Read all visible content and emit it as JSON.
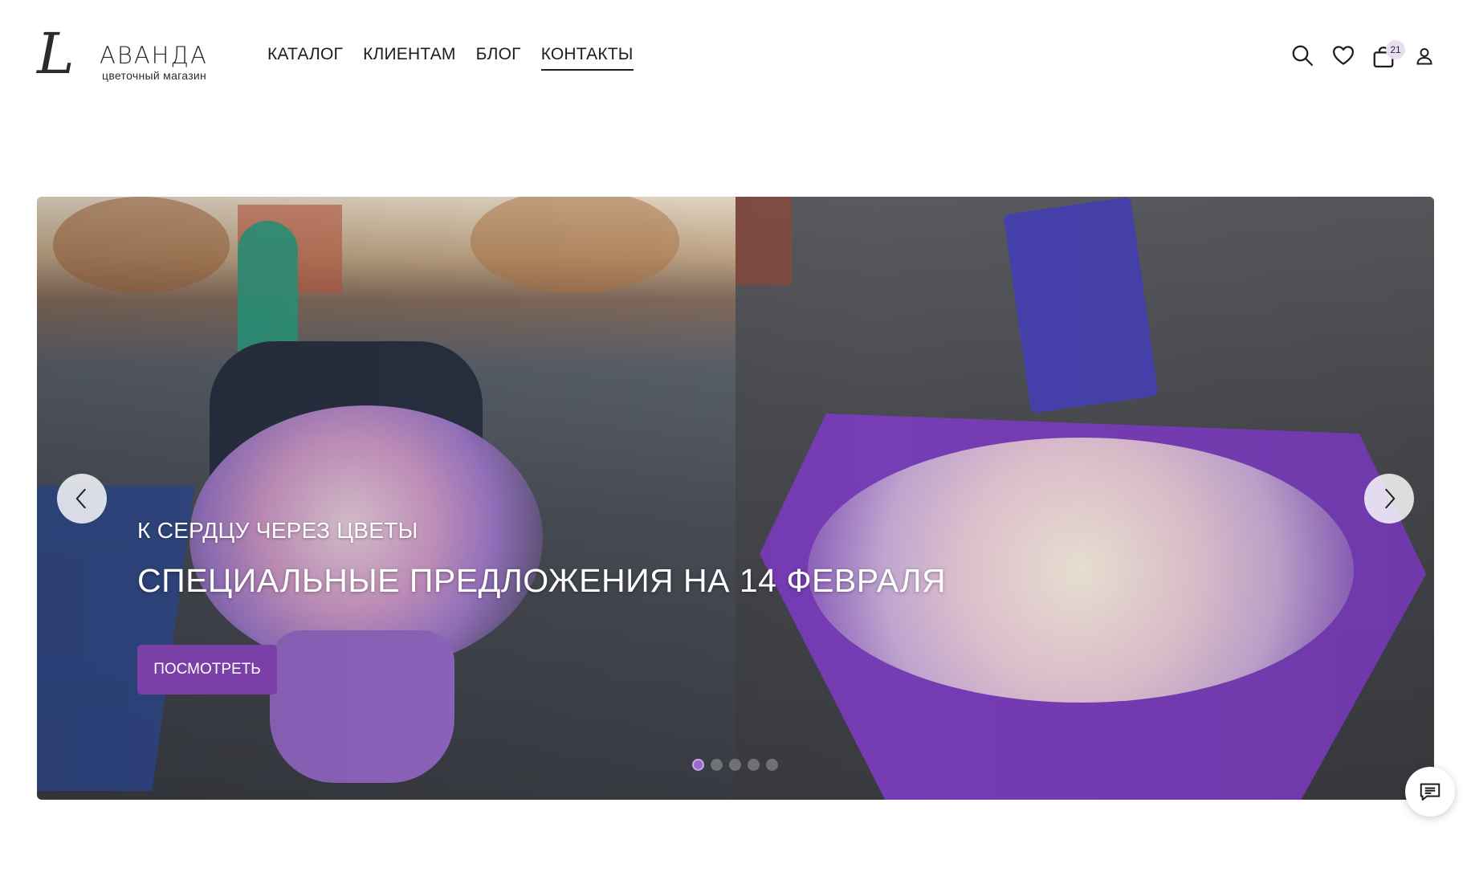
{
  "brand": {
    "script_letter": "L",
    "name": "АВАНДА",
    "tagline": "цветочный магазин"
  },
  "nav": {
    "items": [
      {
        "label": "КАТАЛОГ"
      },
      {
        "label": "КЛИЕНТАМ"
      },
      {
        "label": "БЛОГ"
      },
      {
        "label": "КОНТАКТЫ"
      }
    ],
    "active_index": 3
  },
  "tools": {
    "search_icon": "search-icon",
    "favorites_icon": "heart-icon",
    "cart_icon": "shopping-bag-icon",
    "cart_count": "21",
    "account_icon": "user-icon"
  },
  "hero": {
    "subtitle": "К СЕРДЦУ ЧЕРЕЗ ЦВЕТЫ",
    "title": "СПЕЦИАЛЬНЫЕ ПРЕДЛОЖЕНИЯ НА 14 ФЕВРАЛЯ",
    "button_label": "ПОСМОТРЕТЬ",
    "prev_icon": "chevron-left-icon",
    "next_icon": "chevron-right-icon",
    "slide_count": 5,
    "active_slide": 1
  },
  "chat": {
    "icon": "chat-icon"
  },
  "colors": {
    "accent": "#7b3fa8",
    "text": "#1d1d1d",
    "badge": "#e9def4"
  }
}
